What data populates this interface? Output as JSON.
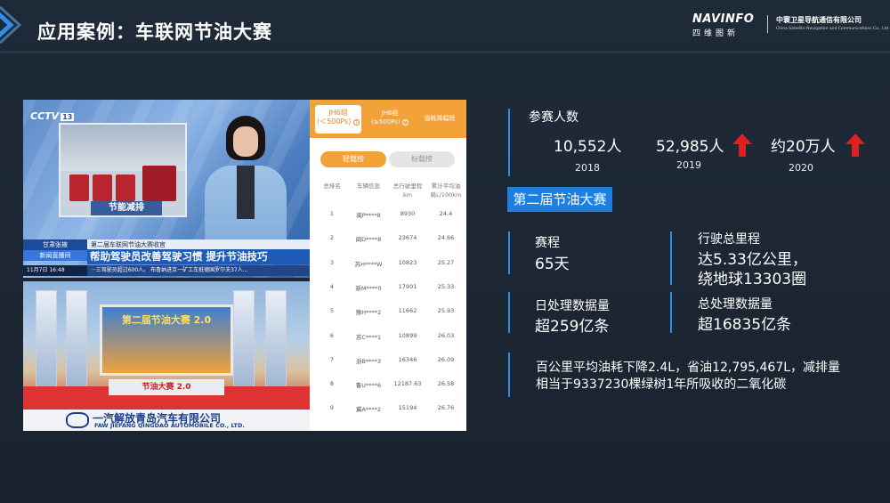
{
  "header": {
    "title": "应用案例：车联网节油大赛",
    "logo_text": "NAVINFO",
    "logo_cn": "四维图新",
    "company_cn": "中寰卫星导航通信有限公司",
    "company_en": "China Satellite Navigation and Communications Co., Ltd."
  },
  "tv": {
    "channel": "CCTV",
    "channel_num": "13",
    "inset_caption": "节能减排",
    "tag1": "甘肃张掖",
    "tag2": "新闻直播间",
    "subtitle": "第二届车联网节油大赛收官",
    "headline": "帮助驾驶员改善驾驶习惯 提升节油技巧",
    "date": "11月7日 16:48",
    "scroll": "···三驾驶员超过600人。 布鲁纳进京一矿工车抵德国罗尔夫37人..."
  },
  "event": {
    "arch_text": "第二届节油大赛 2.0",
    "stage_sign": "节油大赛 2.0",
    "banner_cn": "一汽解放青岛汽车有限公司",
    "banner_en": "FAW JIEFANG QINGDAO AUTOMOBILE CO., LTD."
  },
  "board": {
    "tabs": [
      "JH6组\n(＜500Ps)",
      "JH6组\n(≥500Ps)",
      "油耗降幅榜"
    ],
    "segments": [
      "轻载榜",
      "标载榜"
    ],
    "columns": [
      "总排名",
      "车辆信息",
      "总行驶里程\nkm",
      "累计平均油\n耗L/100km"
    ],
    "rows": [
      [
        "1",
        "闽P****8",
        "8930",
        "24.4"
      ],
      [
        "2",
        "闽D****8",
        "23674",
        "24.66"
      ],
      [
        "3",
        "苏H****W",
        "10823",
        "25.27"
      ],
      [
        "4",
        "新M****0",
        "17901",
        "25.33"
      ],
      [
        "5",
        "豫H****2",
        "11662",
        "25.93"
      ],
      [
        "6",
        "苏C****1",
        "10899",
        "26.03"
      ],
      [
        "7",
        "浙B****3",
        "16346",
        "26.09"
      ],
      [
        "8",
        "鲁U****6",
        "12187.63",
        "26.58"
      ],
      [
        "9",
        "冀A****2",
        "15194",
        "26.76"
      ]
    ]
  },
  "stats": {
    "participants_label": "参赛人数",
    "years": [
      {
        "value": "10,552人",
        "year": "2018"
      },
      {
        "value": "52,985人",
        "year": "2019"
      },
      {
        "value": "约20万人",
        "year": "2020"
      }
    ],
    "badge": "第二届节油大赛",
    "duration_label": "赛程",
    "duration_value": "65天",
    "mileage_label": "行驶总里程",
    "mileage_value1": "达5.33亿公里，",
    "mileage_value2": "绕地球13303圈",
    "daily_label": "日处理数据量",
    "daily_value": "超259亿条",
    "total_label": "总处理数据量",
    "total_value": "超16835亿条",
    "summary": "百公里平均油耗下降2.4L，省油12,795,467L，减排量相当于9337230棵绿树1年所吸收的二氧化碳"
  },
  "colors": {
    "accent": "#1f7fe0",
    "arrow": "#e02020",
    "board_orange": "#f3a23a"
  }
}
